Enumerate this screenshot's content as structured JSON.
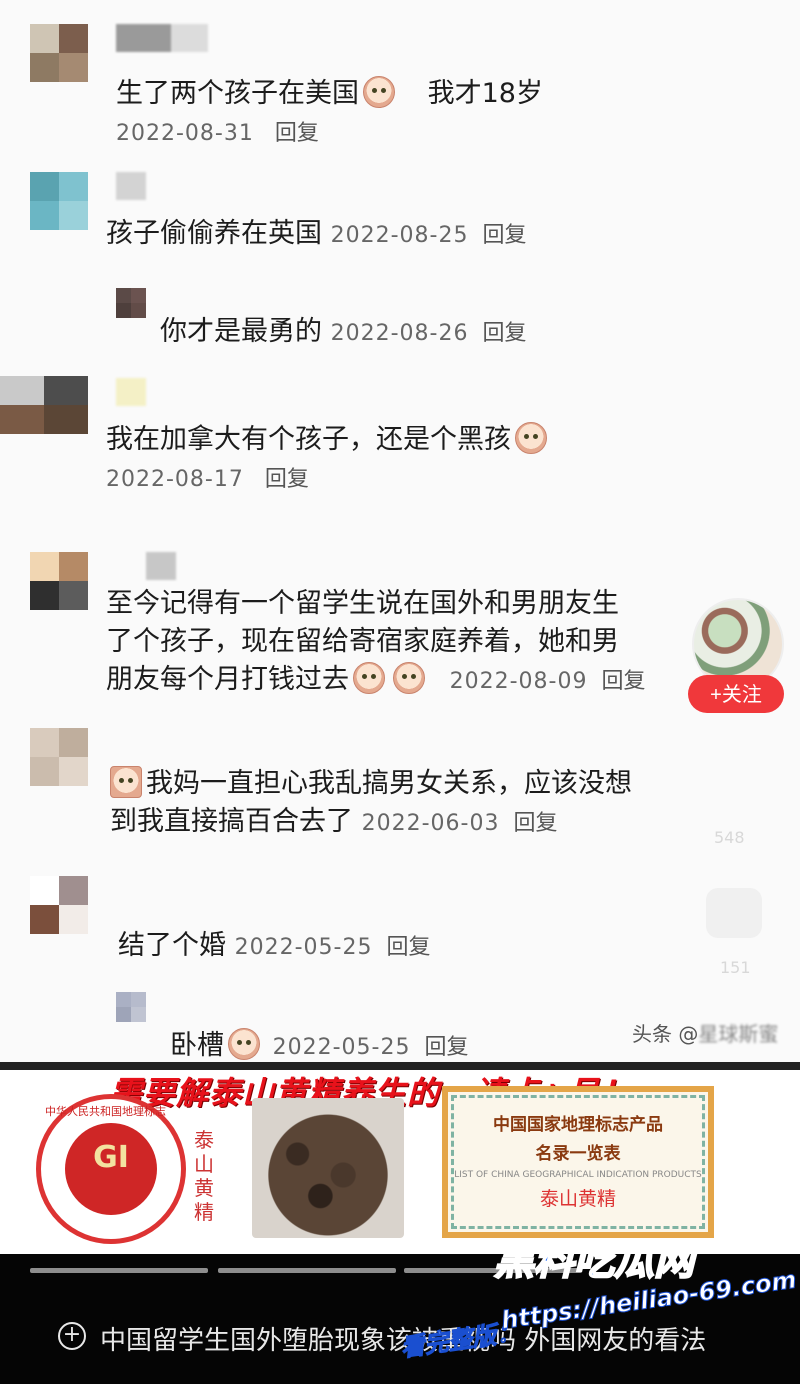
{
  "comments": [
    {
      "text": "生了两个孩子在美国",
      "suffix": "我才18岁",
      "date": "2022-08-31",
      "reply": "回复"
    },
    {
      "text": "孩子偷偷养在英国",
      "date": "2022-08-25",
      "reply": "回复"
    },
    {
      "text": "你才是最勇的",
      "date": "2022-08-26",
      "reply": "回复"
    },
    {
      "text": "我在加拿大有个孩子，还是个黑孩",
      "date": "2022-08-17",
      "reply": "回复"
    },
    {
      "line1": "至今记得有一个留学生说在国外和男朋友生",
      "line2": "了个孩子，现在留给寄宿家庭养着，她和男",
      "line3": "朋友每个月打钱过去",
      "date": "2022-08-09",
      "reply": "回复"
    },
    {
      "line1": "我妈一直担心我乱搞男女关系，应该没想",
      "line2": "到我直接搞百合去了",
      "date": "2022-06-03",
      "reply": "回复"
    },
    {
      "text": "结了个婚",
      "date": "2022-05-25",
      "reply": "回复"
    },
    {
      "text": "卧槽",
      "date": "2022-05-25",
      "reply": "回复"
    }
  ],
  "follow": {
    "label": "+关注"
  },
  "side_counts": {
    "likes": "548",
    "comments": "151"
  },
  "watermark": {
    "prefix": "头条 @",
    "name": "星球斯蜜"
  },
  "ad": {
    "headline": "需要解泰山黄精养生的，请点+号！",
    "gi_text": "GI",
    "gi_ring": "中华人民共和国地理标志",
    "gi_caption": "泰山黄精",
    "cert_line1": "中国国家地理标志产品",
    "cert_line2": "名录一览表",
    "cert_small": "LIST OF CHINA GEOGRAPHICAL INDICATION PRODUCTS",
    "cert_name": "泰山黄精"
  },
  "bottom": {
    "title": "中国留学生国外堕胎现象该被重视吗 外国网友的看法",
    "brand": "黑料吃瓜网",
    "url_label": "看完整版：",
    "url": "https://heiliao-69.com"
  },
  "colors": {
    "accent": "#f0383b",
    "brand_blue": "#1f6bff",
    "ad_red": "#e8121b"
  }
}
